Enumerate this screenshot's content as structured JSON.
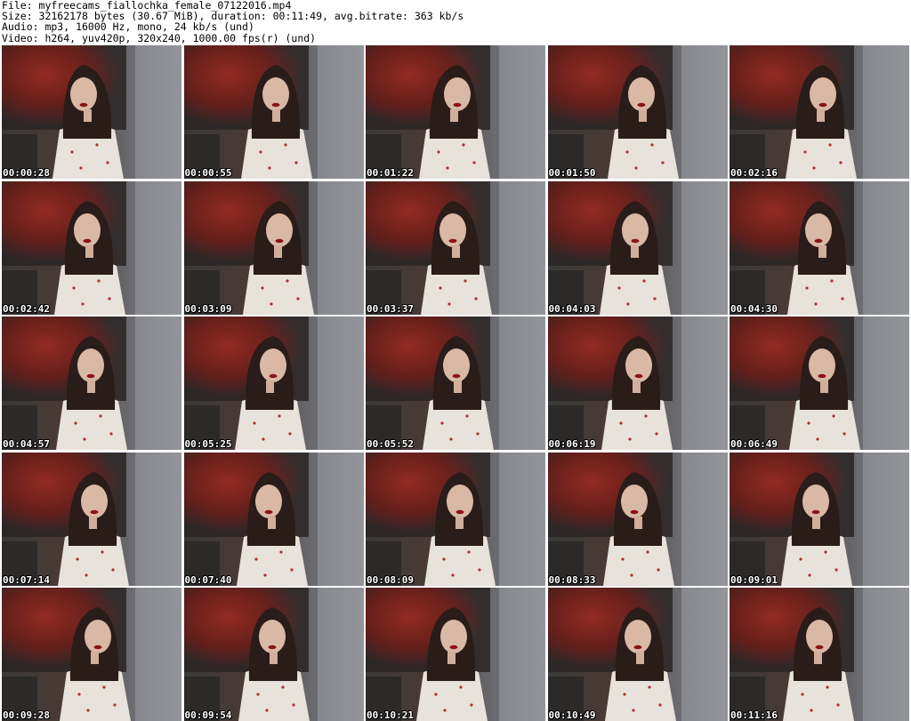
{
  "header": {
    "file_line": "File: myfreecams_fiallochka_female_07122016.mp4",
    "size_line": "Size: 32162178 bytes (30.67 MiB), duration: 00:11:49, avg.bitrate: 363 kb/s",
    "audio_line": "Audio: mp3, 16000 Hz, mono, 24 kb/s (und)",
    "video_line": "Video: h264, yuv420p, 320x240, 1000.00 fps(r) (und)"
  },
  "thumbnails": [
    {
      "time": "00:00:28"
    },
    {
      "time": "00:00:55"
    },
    {
      "time": "00:01:22"
    },
    {
      "time": "00:01:50"
    },
    {
      "time": "00:02:16"
    },
    {
      "time": "00:02:42"
    },
    {
      "time": "00:03:09"
    },
    {
      "time": "00:03:37"
    },
    {
      "time": "00:04:03"
    },
    {
      "time": "00:04:30"
    },
    {
      "time": "00:04:57"
    },
    {
      "time": "00:05:25"
    },
    {
      "time": "00:05:52"
    },
    {
      "time": "00:06:19"
    },
    {
      "time": "00:06:49"
    },
    {
      "time": "00:07:14"
    },
    {
      "time": "00:07:40"
    },
    {
      "time": "00:08:09"
    },
    {
      "time": "00:08:33"
    },
    {
      "time": "00:09:01"
    },
    {
      "time": "00:09:28"
    },
    {
      "time": "00:09:54"
    },
    {
      "time": "00:10:21"
    },
    {
      "time": "00:10:49"
    },
    {
      "time": "00:11:16"
    }
  ],
  "colors": {
    "background": "#ffffff",
    "header_text": "#000000",
    "timestamp_text": "#ffffff",
    "timestamp_outline": "#000000"
  }
}
